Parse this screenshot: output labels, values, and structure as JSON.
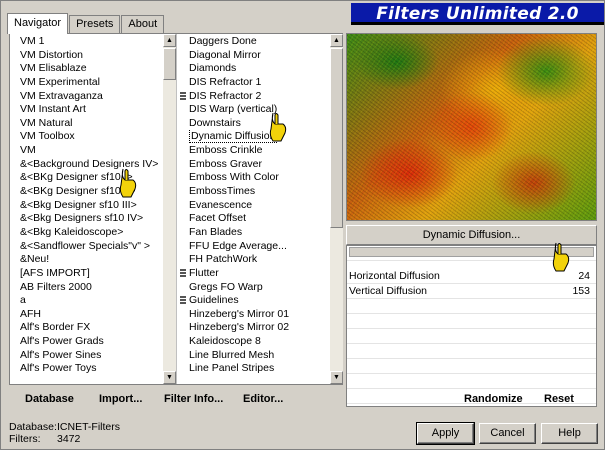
{
  "window": {
    "title": "Filters Unlimited 2.0"
  },
  "tabs": [
    {
      "label": "Navigator",
      "active": true
    },
    {
      "label": "Presets",
      "active": false
    },
    {
      "label": "About",
      "active": false
    }
  ],
  "categories": [
    "VM 1",
    "VM Distortion",
    "VM Elisablaze",
    "VM Experimental",
    "VM Extravaganza",
    "VM Instant Art",
    "VM Natural",
    "VM Toolbox",
    "VM",
    "&<Background Designers IV>",
    "&<BKg Designer sf10 I>",
    "&<BKg Designer sf10 II>",
    "&<Bkg Designer sf10 III>",
    "&<Bkg Designers sf10 IV>",
    "&<Bkg Kaleidoscope>",
    "&<Sandflower Specials\"v\" >",
    "&Neu!",
    "[AFS IMPORT]",
    "AB Filters 2000",
    "a",
    "AFH",
    "Alf's Border FX",
    "Alf's Power Grads",
    "Alf's Power Sines",
    "Alf's Power Toys"
  ],
  "filters": [
    {
      "label": "Daggers Done"
    },
    {
      "label": "Diagonal Mirror"
    },
    {
      "label": "Diamonds"
    },
    {
      "label": "DIS Refractor 1"
    },
    {
      "label": "DIS Refractor 2",
      "folder": true
    },
    {
      "label": "DIS Warp (vertical)"
    },
    {
      "label": "Downstairs"
    },
    {
      "label": "Dynamic Diffusion",
      "selected": true
    },
    {
      "label": "Emboss Crinkle"
    },
    {
      "label": "Emboss Graver"
    },
    {
      "label": "Emboss With Color"
    },
    {
      "label": "EmbossTimes"
    },
    {
      "label": "Evanescence"
    },
    {
      "label": "Facet Offset"
    },
    {
      "label": "Fan Blades"
    },
    {
      "label": "FFU Edge Average..."
    },
    {
      "label": "FH PatchWork"
    },
    {
      "label": "Flutter",
      "folder": true
    },
    {
      "label": "Gregs FO Warp"
    },
    {
      "label": "Guidelines",
      "folder": true
    },
    {
      "label": "Hinzeberg's Mirror 01"
    },
    {
      "label": "Hinzeberg's Mirror 02"
    },
    {
      "label": "Kaleidoscope 8"
    },
    {
      "label": "Line Blurred Mesh"
    },
    {
      "label": "Line Panel Stripes"
    }
  ],
  "navbar": {
    "database": "Database",
    "import": "Import...",
    "filter_info": "Filter Info...",
    "editor": "Editor..."
  },
  "filter_panel": {
    "name": "Dynamic Diffusion...",
    "params": [
      {
        "name": "Horizontal Diffusion",
        "value": "24"
      },
      {
        "name": "Vertical Diffusion",
        "value": "153"
      }
    ],
    "randomize": "Randomize",
    "reset": "Reset"
  },
  "footer": {
    "database_label": "Database:",
    "database_value": "ICNET-Filters",
    "filters_label": "Filters:",
    "filters_value": "3472"
  },
  "buttons": {
    "apply": "Apply",
    "cancel": "Cancel",
    "help": "Help"
  },
  "colors": {
    "banner": "#0a1aa8",
    "panel": "#d4d0c8",
    "hand": "#f2d20a"
  }
}
